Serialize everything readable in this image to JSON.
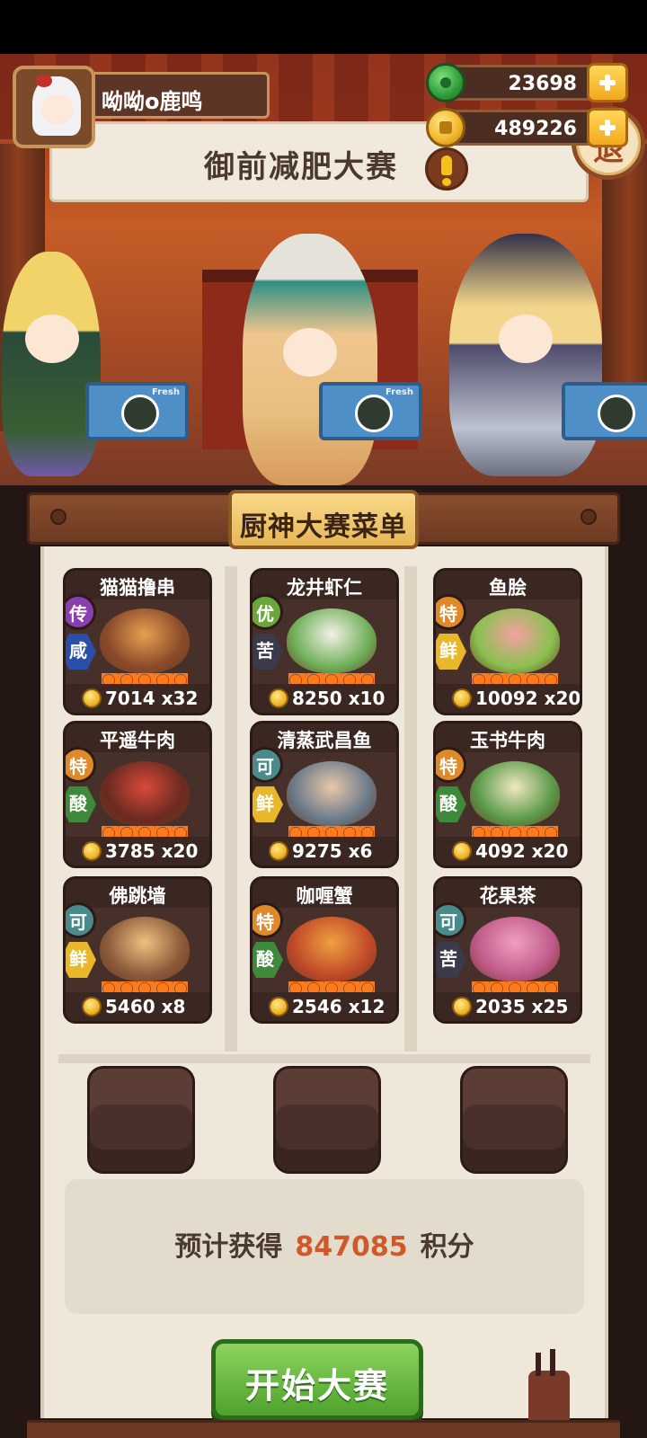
{
  "player": {
    "name": "呦呦o鹿鸣"
  },
  "resources": {
    "jade": "23698",
    "coins": "489226"
  },
  "event": {
    "title": "御前减肥大赛",
    "exit_label": "退",
    "crate_label": "Fresh"
  },
  "menu": {
    "title": "厨神大赛菜单",
    "dishes": [
      {
        "name": "猫猫撸串",
        "grade": "传",
        "flavor": "咸",
        "price": "7014",
        "qty": "x32",
        "grade_color": "#8a3fb0",
        "flavor_color": "#2a4fa8",
        "c1": "#e8a050",
        "c2": "#8a4a2a"
      },
      {
        "name": "龙井虾仁",
        "grade": "优",
        "flavor": "苦",
        "price": "8250",
        "qty": "x10",
        "grade_color": "#6aa63a",
        "flavor_color": "#3a3a4a",
        "c1": "#f4f0e6",
        "c2": "#6fb05a"
      },
      {
        "name": "鱼脍",
        "grade": "特",
        "flavor": "鲜",
        "price": "10092",
        "qty": "x20",
        "grade_color": "#e0892a",
        "flavor_color": "#e8b82a",
        "c1": "#f4a0a0",
        "c2": "#8ac050"
      },
      {
        "name": "平遥牛肉",
        "grade": "特",
        "flavor": "酸",
        "price": "3785",
        "qty": "x20",
        "grade_color": "#e0892a",
        "flavor_color": "#3f8a3a",
        "c1": "#d84a3a",
        "c2": "#6a2a20"
      },
      {
        "name": "清蒸武昌鱼",
        "grade": "可",
        "flavor": "鲜",
        "price": "9275",
        "qty": "x6",
        "grade_color": "#4a8a8a",
        "flavor_color": "#e8b82a",
        "c1": "#e8c8a8",
        "c2": "#6a7a8a"
      },
      {
        "name": "玉书牛肉",
        "grade": "特",
        "flavor": "酸",
        "price": "4092",
        "qty": "x20",
        "grade_color": "#e0892a",
        "flavor_color": "#3f8a3a",
        "c1": "#f0e8c0",
        "c2": "#5a9a4a"
      },
      {
        "name": "佛跳墙",
        "grade": "可",
        "flavor": "鲜",
        "price": "5460",
        "qty": "x8",
        "grade_color": "#4a8a8a",
        "flavor_color": "#e8b82a",
        "c1": "#f0c080",
        "c2": "#8a5a3a"
      },
      {
        "name": "咖喱蟹",
        "grade": "特",
        "flavor": "酸",
        "price": "2546",
        "qty": "x12",
        "grade_color": "#e0892a",
        "flavor_color": "#3f8a3a",
        "c1": "#f0a040",
        "c2": "#c04a2a"
      },
      {
        "name": "花果茶",
        "grade": "可",
        "flavor": "苦",
        "price": "2035",
        "qty": "x25",
        "grade_color": "#4a8a8a",
        "flavor_color": "#3a3a4a",
        "c1": "#f0a0c0",
        "c2": "#c05a8a"
      }
    ]
  },
  "estimate": {
    "prefix": "预计获得",
    "value": "847085",
    "suffix": "积分"
  },
  "start_button": {
    "label": "开始大赛"
  }
}
